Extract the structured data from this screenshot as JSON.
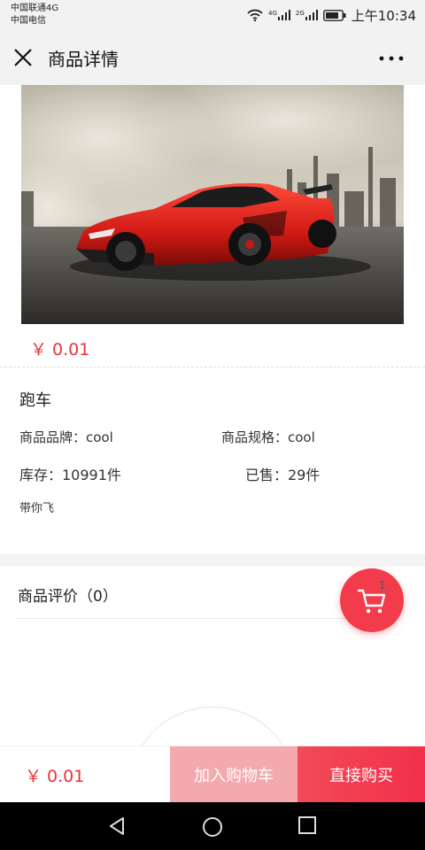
{
  "status_bar": {
    "carrier_1": "中国联通4G",
    "carrier_2": "中国电信",
    "network_1": "4G",
    "network_2": "2G",
    "time": "上午10:34"
  },
  "nav": {
    "title": "商品详情",
    "close_icon": "close-icon",
    "more_icon": "more-dots-icon"
  },
  "product": {
    "image_icon": "car-photo",
    "price": "￥ 0.01",
    "name": "跑车",
    "brand": "商品品牌：cool",
    "spec": "商品规格：cool",
    "stock": "库存：10991件",
    "sold": "已售：29件",
    "description": "带你飞"
  },
  "reviews": {
    "title": "商品评价（0）"
  },
  "cart_fab": {
    "count": "1",
    "icon": "cart-icon",
    "color": "#f33c4b"
  },
  "bottom_bar": {
    "price": "￥ 0.01",
    "add_to_cart": "加入购物车",
    "buy_now": "直接购买"
  },
  "colors": {
    "accent": "#e8343a",
    "add_cart_bg": "#f3aaae",
    "buy_bg": "#f2304a"
  }
}
